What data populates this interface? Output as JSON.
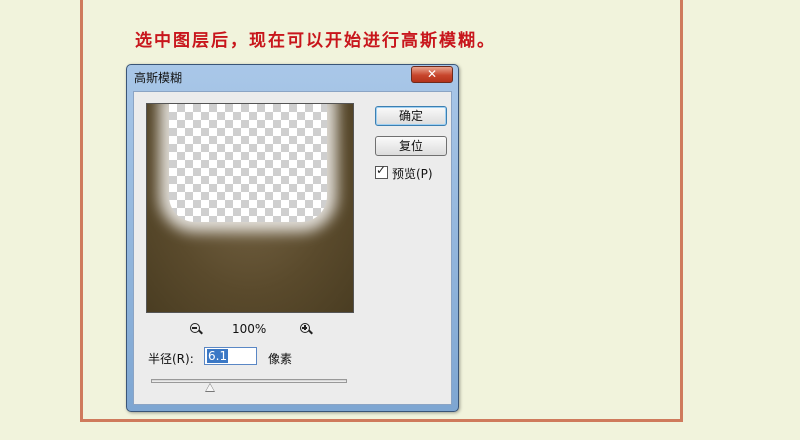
{
  "caption": "选中图层后，现在可以开始进行高斯模糊。",
  "dialog": {
    "title": "高斯模糊",
    "close_label": "✕",
    "ok_label": "确定",
    "reset_label": "复位",
    "preview_label": "预览(P)",
    "preview_checked": true,
    "zoom_level": "100%",
    "zoom_out_icon": "zoom-out-icon",
    "zoom_in_icon": "zoom-in-icon",
    "radius_label": "半径(R):",
    "radius_value": "6.1",
    "radius_unit": "像素",
    "radius_slider_fraction": 0.3
  }
}
